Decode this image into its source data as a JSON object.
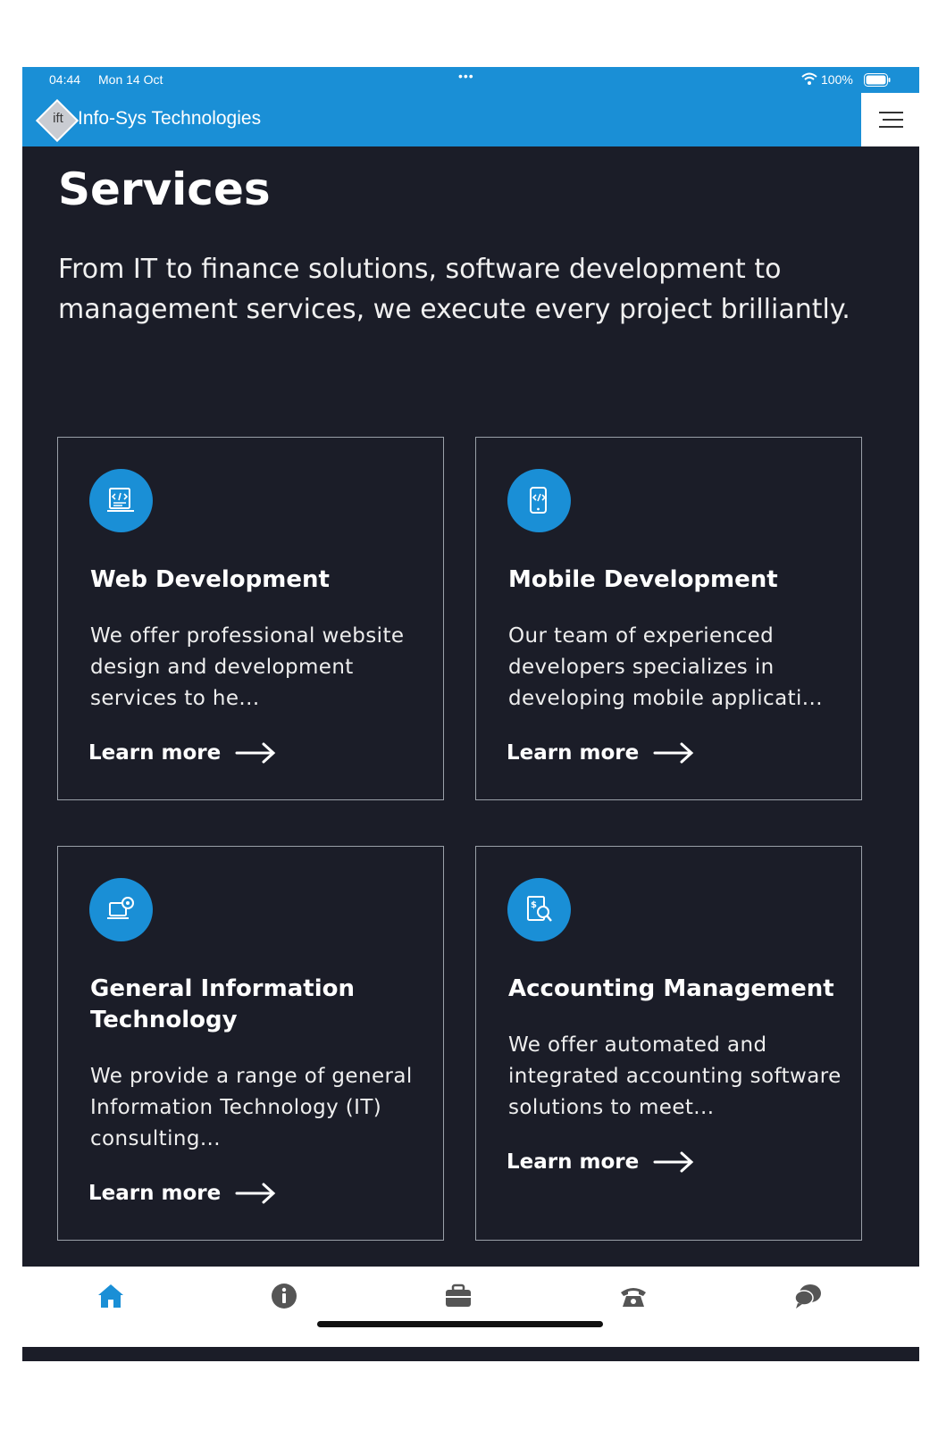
{
  "status_bar": {
    "time": "04:44",
    "date": "Mon 14 Oct",
    "battery": "100%"
  },
  "header": {
    "logo_text": "ift",
    "brand_name": "Info-Sys Technologies"
  },
  "main": {
    "title": "Services",
    "intro": "From IT to finance solutions, software development to management services, we execute every project brilliantly.",
    "services": [
      {
        "icon": "web-code-icon",
        "title": "Web Development",
        "description": "We offer professional website design and development services to he...",
        "cta": "Learn more"
      },
      {
        "icon": "mobile-code-icon",
        "title": "Mobile Development",
        "description": "Our team of experienced developers specializes in developing mobile applicati...",
        "cta": "Learn more"
      },
      {
        "icon": "laptop-gear-icon",
        "title": "General Information Technology",
        "description": "We provide a range of general Information Technology (IT) consulting...",
        "cta": "Learn more"
      },
      {
        "icon": "invoice-search-icon",
        "title": "Accounting Management",
        "description": "We offer automated and integrated accounting software solutions to meet...",
        "cta": "Learn more"
      }
    ]
  },
  "tab_bar": {
    "items": [
      {
        "icon": "home-icon",
        "active": true
      },
      {
        "icon": "info-icon",
        "active": false
      },
      {
        "icon": "briefcase-icon",
        "active": false
      },
      {
        "icon": "phone-icon",
        "active": false
      },
      {
        "icon": "chat-icon",
        "active": false
      }
    ]
  },
  "colors": {
    "accent": "#1a8fd6",
    "background": "#1b1d28",
    "tab_inactive": "#555555"
  }
}
